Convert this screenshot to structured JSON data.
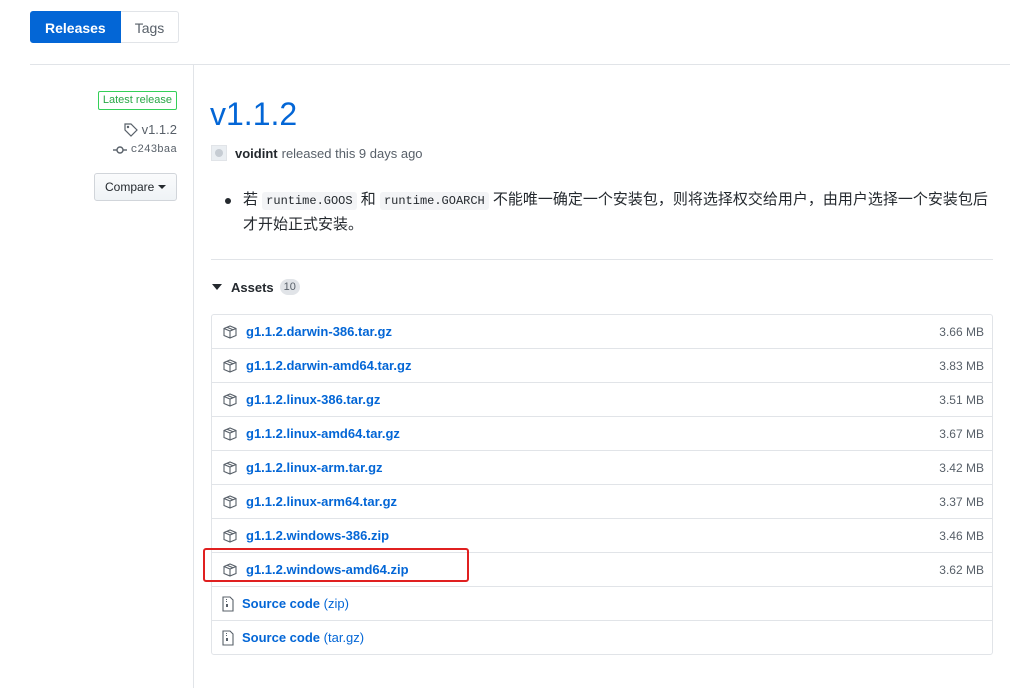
{
  "nav": {
    "releases_label": "Releases",
    "tags_label": "Tags"
  },
  "meta": {
    "latest_badge": "Latest release",
    "tag": "v1.1.2",
    "commit": "c243baa",
    "compare_label": "Compare"
  },
  "release": {
    "title": "v1.1.2",
    "author": "voidint",
    "released_text": "released this 9 days ago",
    "notes": {
      "prefix": "若 ",
      "code1": "runtime.GOOS",
      "mid": " 和 ",
      "code2": "runtime.GOARCH",
      "suffix": " 不能唯一确定一个安装包，则将选择权交给用户，由用户选择一个安装包后才开始正式安装。"
    }
  },
  "assets": {
    "label": "Assets",
    "count": "10",
    "files": [
      {
        "name": "g1.1.2.darwin-386.tar.gz",
        "size": "3.66 MB"
      },
      {
        "name": "g1.1.2.darwin-amd64.tar.gz",
        "size": "3.83 MB"
      },
      {
        "name": "g1.1.2.linux-386.tar.gz",
        "size": "3.51 MB"
      },
      {
        "name": "g1.1.2.linux-amd64.tar.gz",
        "size": "3.67 MB"
      },
      {
        "name": "g1.1.2.linux-arm.tar.gz",
        "size": "3.42 MB"
      },
      {
        "name": "g1.1.2.linux-arm64.tar.gz",
        "size": "3.37 MB"
      },
      {
        "name": "g1.1.2.windows-386.zip",
        "size": "3.46 MB"
      },
      {
        "name": "g1.1.2.windows-amd64.zip",
        "size": "3.62 MB"
      }
    ],
    "sources": [
      {
        "label": "Source code",
        "format": "(zip)"
      },
      {
        "label": "Source code",
        "format": "(tar.gz)"
      }
    ]
  },
  "colors": {
    "link": "#0366d6",
    "accent_green": "#28a745",
    "highlight_red": "#e02020"
  }
}
